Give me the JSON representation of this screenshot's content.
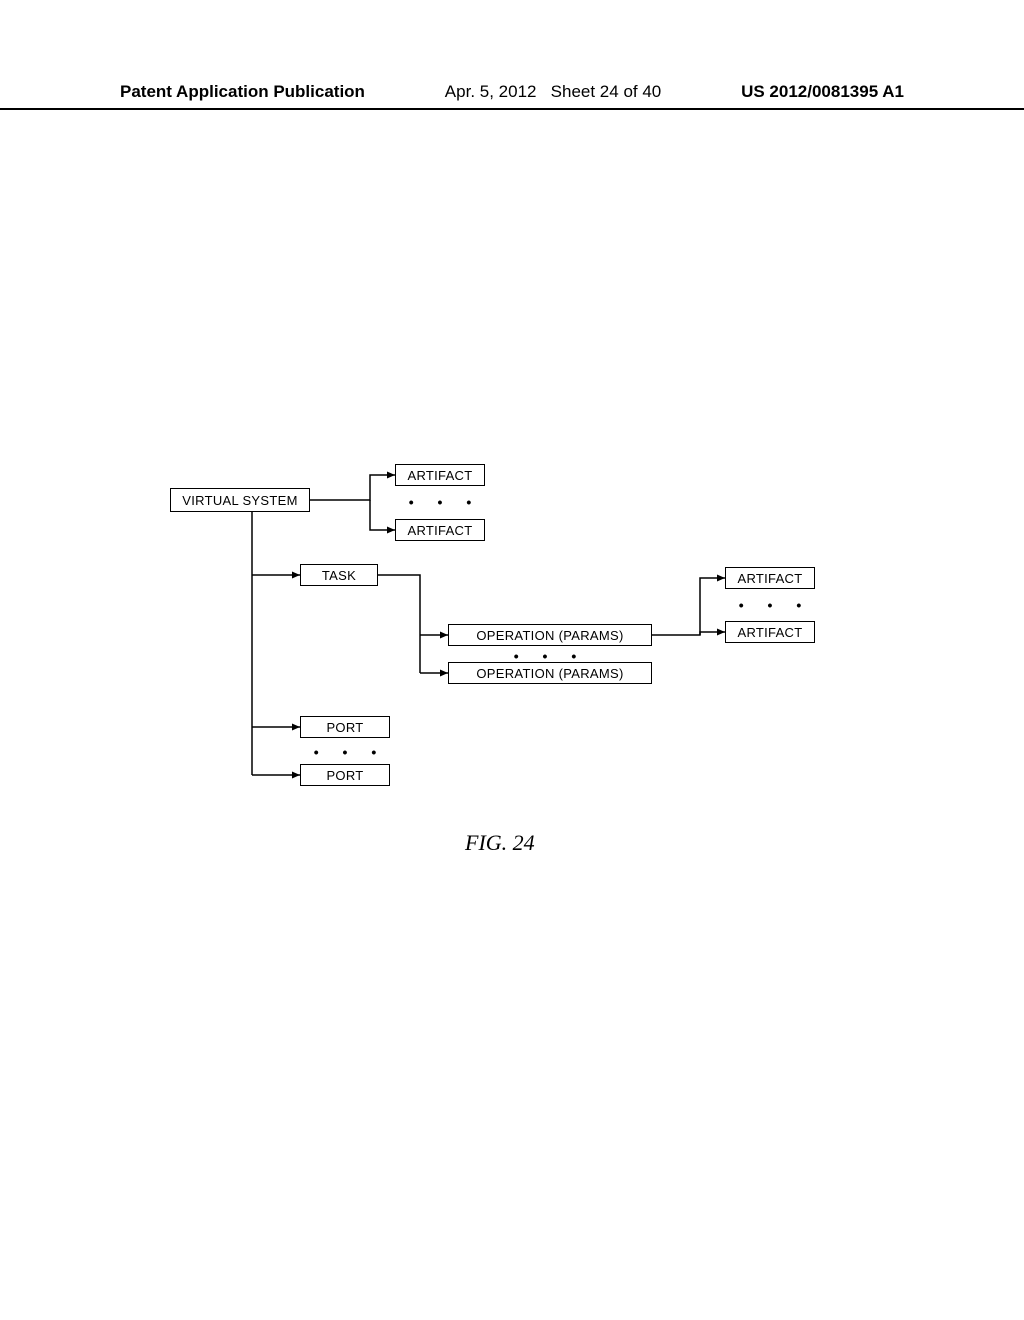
{
  "header": {
    "pub_type": "Patent Application Publication",
    "date": "Apr. 5, 2012",
    "sheet": "Sheet 24 of 40",
    "pub_no": "US 2012/0081395 A1"
  },
  "nodes": {
    "virtual_system": "VIRTUAL SYSTEM",
    "artifact_top_1": "ARTIFACT",
    "artifact_top_2": "ARTIFACT",
    "task": "TASK",
    "operation_1": "OPERATION (PARAMS)",
    "operation_2": "OPERATION (PARAMS)",
    "artifact_right_1": "ARTIFACT",
    "artifact_right_2": "ARTIFACT",
    "port_1": "PORT",
    "port_2": "PORT"
  },
  "ellipses": {
    "dot3": "•   •   •"
  },
  "figure_label": "FIG. 24"
}
